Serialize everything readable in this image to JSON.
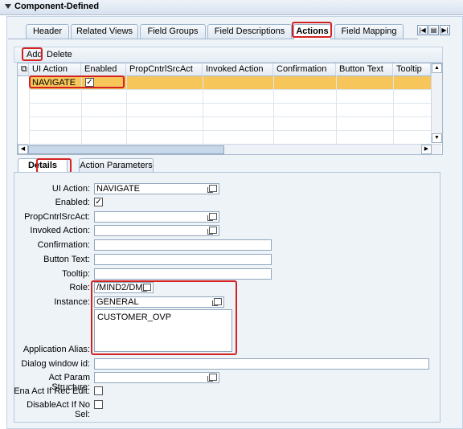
{
  "panel": {
    "title": "Component-Defined"
  },
  "tabs": [
    {
      "label": "Header"
    },
    {
      "label": "Related Views"
    },
    {
      "label": "Field Groups"
    },
    {
      "label": "Field Descriptions"
    },
    {
      "label": "Actions"
    },
    {
      "label": "Field Mapping"
    }
  ],
  "toolbar": {
    "add_label": "Add",
    "delete_label": "Delete"
  },
  "grid": {
    "columns": [
      "UI Action",
      "Enabled",
      "PropCntrlSrcAct",
      "Invoked Action",
      "Confirmation",
      "Button Text",
      "Tooltip"
    ],
    "rows": [
      {
        "ui_action": "NAVIGATE",
        "enabled": "✓"
      }
    ]
  },
  "subtabs": [
    {
      "label": "Details"
    },
    {
      "label": "Action Parameters"
    }
  ],
  "form": {
    "ui_action": {
      "label": "UI Action:",
      "value": "NAVIGATE"
    },
    "enabled": {
      "label": "Enabled:",
      "value": "✓"
    },
    "propcntrl": {
      "label": "PropCntrlSrcAct:",
      "value": ""
    },
    "invoked": {
      "label": "Invoked Action:",
      "value": ""
    },
    "confirmation": {
      "label": "Confirmation:",
      "value": ""
    },
    "button_text": {
      "label": "Button Text:",
      "value": ""
    },
    "tooltip": {
      "label": "Tooltip:",
      "value": ""
    },
    "role": {
      "label": "Role:",
      "value": "/MIND2/DMT"
    },
    "instance": {
      "label": "Instance:",
      "value": "GENERAL"
    },
    "instance_list": "CUSTOMER_OVP",
    "app_alias": {
      "label": "Application Alias:"
    },
    "dialog_window": {
      "label": "Dialog window id:",
      "value": ""
    },
    "act_param": {
      "label": "Act Param Structure:",
      "value": ""
    },
    "ena_act": {
      "label": "Ena Act If Rec Edit:"
    },
    "disable_act": {
      "label": "DisableAct If No Sel:"
    }
  },
  "colors": {
    "highlight_row": "#f7c65b",
    "annotation_red": "#d32222"
  }
}
